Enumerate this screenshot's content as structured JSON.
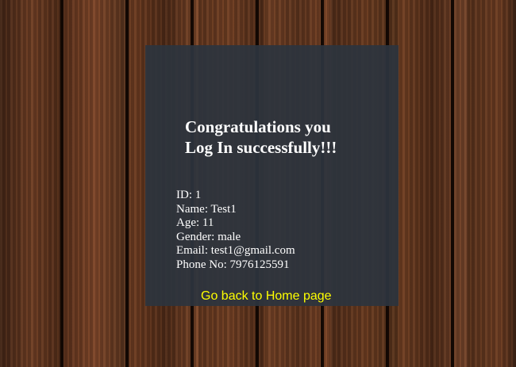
{
  "message": {
    "line1": "Congratulations you",
    "line2": "Log In successfully!!!"
  },
  "user_details": [
    {
      "label": "ID:",
      "value": "1"
    },
    {
      "label": "Name:",
      "value": "Test1"
    },
    {
      "label": "Age:",
      "value": "11"
    },
    {
      "label": "Gender:",
      "value": "male"
    },
    {
      "label": "Email:",
      "value": "test1@gmail.com"
    },
    {
      "label": "Phone No:",
      "value": "7976125591"
    }
  ],
  "home_link": {
    "label": "Go back to Home page"
  },
  "colors": {
    "card_background": "#2c343e",
    "text": "#ffffff",
    "link": "#ffff00"
  }
}
